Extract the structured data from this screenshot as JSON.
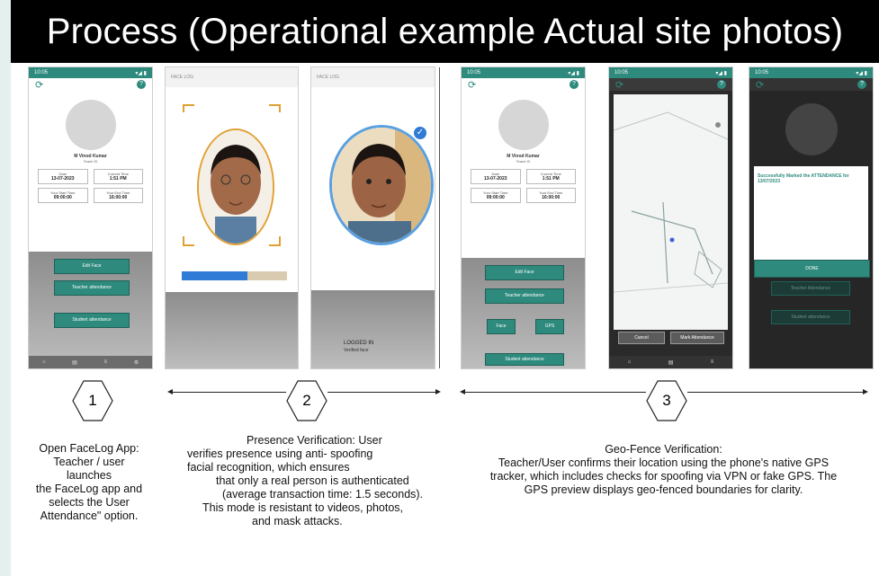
{
  "title": "Process (Operational example Actual site photos)",
  "colors": {
    "teal": "#2d8a7d",
    "title_bg": "#000000",
    "slide_bg": "#e3f0ee"
  },
  "phone1": {
    "status_time": "10:05",
    "status_right": "▾◢ ▮",
    "user_name": "M Vinod Kumar",
    "user_sub": "Teach ID",
    "fields": [
      {
        "label": "Date",
        "value": "13-07-2023"
      },
      {
        "label": "Current Time",
        "value": "1:51 PM"
      },
      {
        "label": "Your Start Time",
        "value": "09:00:00"
      },
      {
        "label": "Your End Time",
        "value": "16:00:00"
      }
    ],
    "buttons": [
      "Edit Face",
      "Teacher attendance",
      "Student attendance"
    ]
  },
  "phone2": {
    "header": "FACE LOG",
    "progress": 0.62
  },
  "phone3": {
    "header": "FACE LOG",
    "footer_title": "LOGGED IN",
    "footer_sub": "Verified face"
  },
  "phone4": {
    "user_name": "M Vinod Kumar",
    "user_sub": "Teach ID",
    "fields": [
      {
        "label": "Date",
        "value": "13-07-2023"
      },
      {
        "label": "Current Time",
        "value": "1:51 PM"
      },
      {
        "label": "Your Start Time",
        "value": "09:00:00"
      },
      {
        "label": "Your End Time",
        "value": "16:00:00"
      }
    ],
    "buttons": [
      "Edit Face",
      "Teacher attendance",
      "Face",
      "GPS",
      "Student attendance"
    ]
  },
  "phone5": {
    "buttons": [
      "Cancel",
      "Mark Attendance"
    ]
  },
  "phone6": {
    "message": "Successfully Marked the ATTENDANCE for 13/07/2023",
    "ok_button": "DONE",
    "menu_items": [
      "Teacher Attendance",
      "Student attendance"
    ]
  },
  "steps": [
    {
      "num": "1",
      "caption": "Open FaceLog App:\nTeacher / user launches\nthe FaceLog app and\nselects the User\nAttendance\" option."
    },
    {
      "num": "2",
      "caption_title": "Presence Verification: User",
      "caption_lines": [
        "verifies presence using anti- spoofing",
        "facial recognition, which ensures",
        "that only a real person is authenticated",
        "(average transaction time: 1.5 seconds).",
        "This mode is resistant to videos, photos,",
        "and mask attacks."
      ]
    },
    {
      "num": "3",
      "caption_lines": [
        "Geo-Fence Verification:",
        "Teacher/User confirms their location using the phone's native GPS",
        "tracker, which includes checks for spoofing via VPN or fake GPS. The",
        "GPS preview displays geo-fenced boundaries for clarity."
      ]
    }
  ]
}
